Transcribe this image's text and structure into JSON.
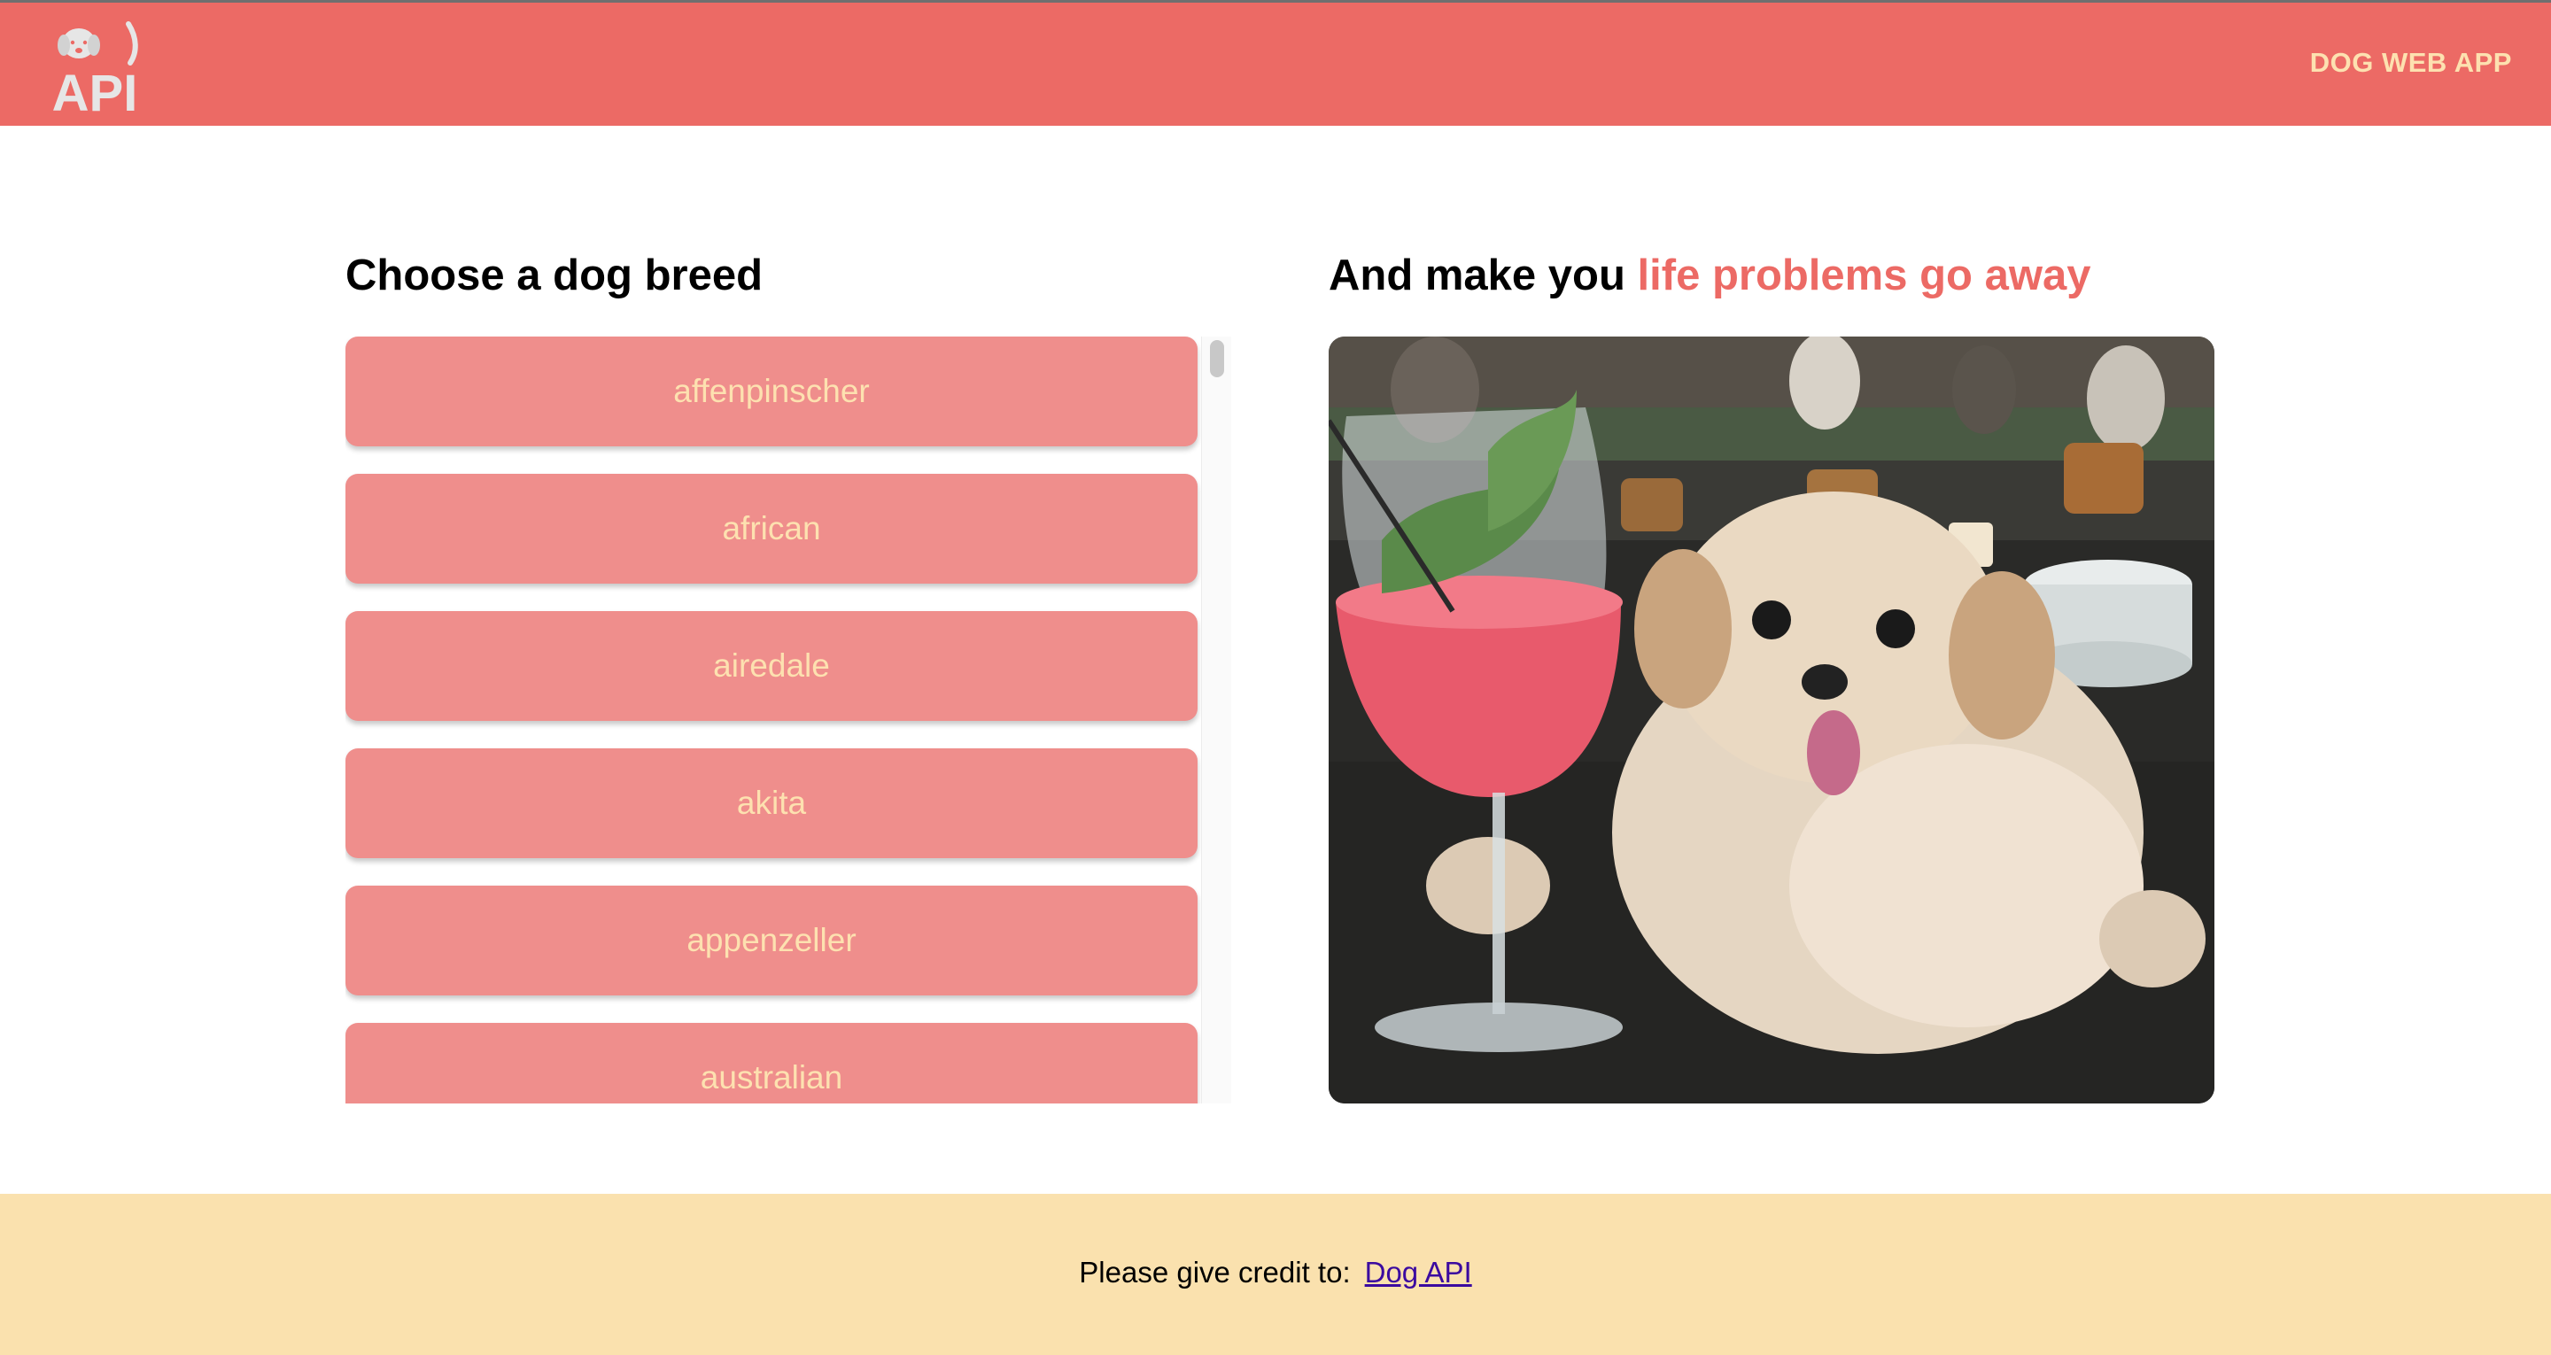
{
  "header": {
    "logo_text": "API",
    "app_title": "DOG WEB APP"
  },
  "left": {
    "heading": "Choose a dog breed",
    "breeds": [
      "affenpinscher",
      "african",
      "airedale",
      "akita",
      "appenzeller",
      "australian"
    ]
  },
  "right": {
    "heading_plain": "And make you ",
    "heading_accent": "life problems go away"
  },
  "footer": {
    "credit_text": "Please give credit to:",
    "link_label": "Dog API"
  },
  "colors": {
    "header_bg": "#ec6a65",
    "accent": "#ec6a65",
    "button_bg": "#ef8e8c",
    "button_text": "#fde1b0",
    "footer_bg": "#fae1ae"
  }
}
